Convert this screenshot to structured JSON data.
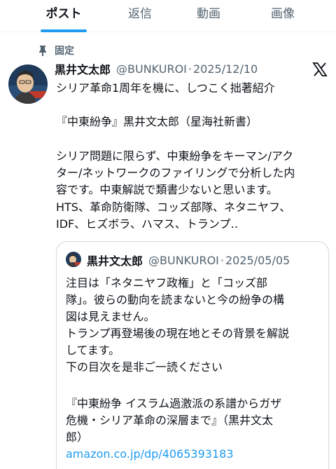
{
  "tabs": [
    {
      "label": "ポスト",
      "active": true
    },
    {
      "label": "返信",
      "active": false
    },
    {
      "label": "動画",
      "active": false
    },
    {
      "label": "画像",
      "active": false
    }
  ],
  "pinned_label": "固定",
  "post": {
    "author": "黒井文太郎",
    "handle": "@BUNKUROI",
    "separator": "·",
    "date": "2025/12/10",
    "lines": [
      "シリア革命1周年を機に、しつこく拙著紹介",
      "『中東紛争』黒井文太郎（星海社新書）",
      "シリア問題に限らず、中東紛争をキーマン/アク",
      "ター/ネットワークのファイリングで分析した内",
      "容です。中東解説で類書少ないと思います。",
      "HTS、革命防衛隊、コッズ部隊、ネタニヤフ、",
      "IDF、ヒズボラ、ハマス、トランプ‥"
    ]
  },
  "quote": {
    "author": "黒井文太郎",
    "handle": "@BUNKUROI",
    "separator": "·",
    "date": "2025/05/05",
    "lines": [
      "注目は「ネタニヤフ政権」と「コッズ部",
      "隊」。彼らの動向を読まないと今の紛争の構",
      "図は見えません。",
      "トランプ再登場後の現在地とその背景を解説",
      "してます。",
      "下の目次を是非ご一読ください",
      "『中東紛争 イスラム過激派の系譜からガザ",
      "危機・シリア革命の深層まで』（黒井文太",
      "郎）"
    ],
    "link": "amazon.co.jp/dp/4065393183"
  },
  "colors": {
    "accent": "#1d9bf0",
    "text": "#0f1419",
    "secondary": "#536471",
    "border": "#cfd9de"
  },
  "icons": {
    "pin": "pin-icon",
    "platform": "x-logo-icon"
  }
}
